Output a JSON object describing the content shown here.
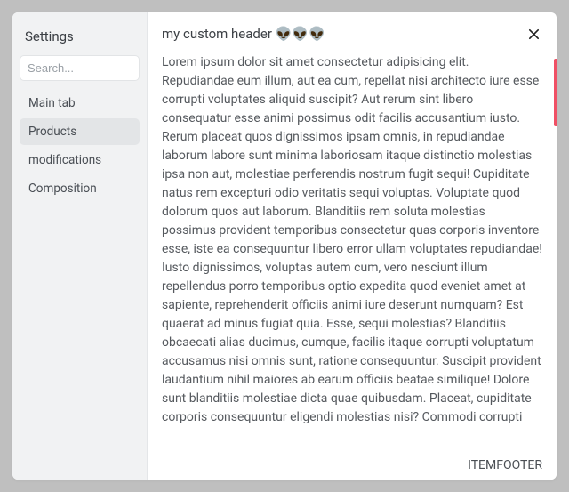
{
  "sidebar": {
    "title": "Settings",
    "search_placeholder": "Search...",
    "items": [
      {
        "label": "Main tab"
      },
      {
        "label": "Products"
      },
      {
        "label": "modifications"
      },
      {
        "label": "Composition"
      }
    ],
    "active_index": 1
  },
  "header": {
    "title": "my custom header 👽👽👽"
  },
  "content": {
    "text": "Lorem ipsum dolor sit amet consectetur adipisicing elit. Repudiandae eum illum, aut ea cum, repellat nisi architecto iure esse corrupti voluptates aliquid suscipit? Aut rerum sint libero consequatur esse animi possimus odit facilis accusantium iusto. Rerum placeat quos dignissimos ipsam omnis, in repudiandae laborum labore sunt minima laboriosam itaque distinctio molestias ipsa non aut, molestiae perferendis nostrum fugit sequi! Cupiditate natus rem excepturi odio veritatis sequi voluptas. Voluptate quod dolorum quos aut laborum. Blanditiis rem soluta molestias possimus provident temporibus consectetur quas corporis inventore esse, iste ea consequuntur libero error ullam voluptates repudiandae! Iusto dignissimos, voluptas autem cum, vero nesciunt illum repellendus porro temporibus optio expedita quod eveniet amet at sapiente, reprehenderit officiis animi iure deserunt numquam? Est quaerat ad minus fugiat quia. Esse, sequi molestias? Blanditiis obcaecati alias ducimus, cumque, facilis itaque corrupti voluptatum accusamus nisi omnis sunt, ratione consequuntur. Suscipit provident laudantium nihil maiores ab earum officiis beatae similique! Dolore sunt blanditiis molestiae dicta quae quibusdam. Placeat, cupiditate corporis consequuntur eligendi molestias nisi? Commodi corrupti"
  },
  "footer": {
    "text": "ITEMFOOTER"
  }
}
